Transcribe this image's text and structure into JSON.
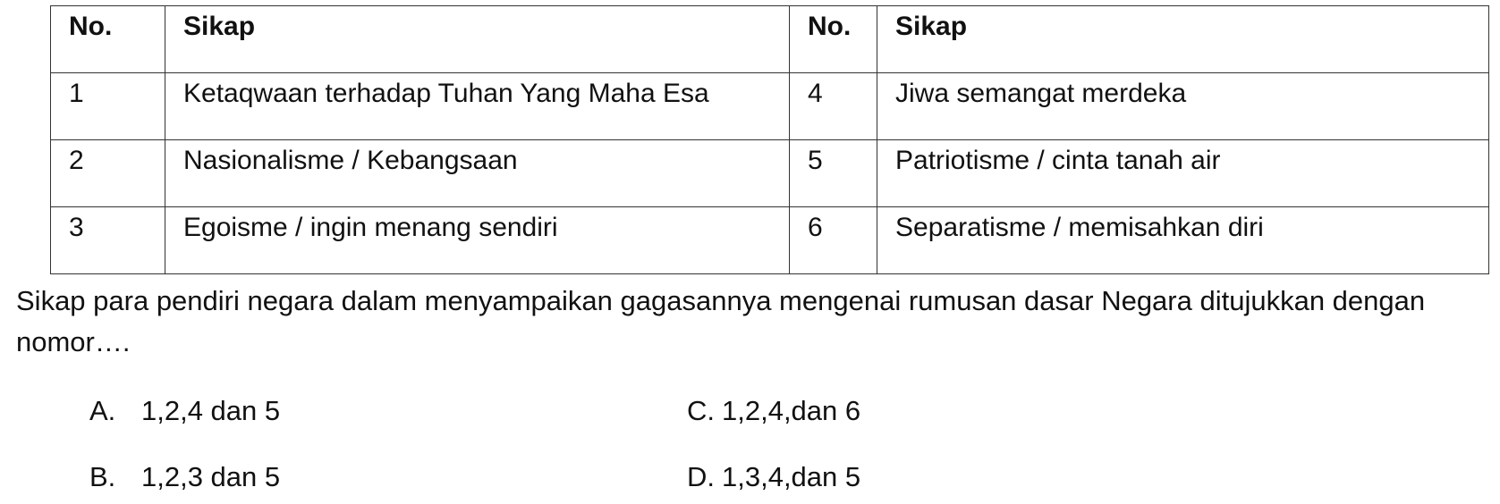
{
  "table": {
    "headers": [
      "No.",
      "Sikap",
      "No.",
      "Sikap"
    ],
    "rows": [
      [
        "1",
        "Ketaqwaan terhadap Tuhan Yang Maha Esa",
        "4",
        "Jiwa semangat merdeka"
      ],
      [
        "2",
        "Nasionalisme / Kebangsaan",
        "5",
        "Patriotisme / cinta tanah air"
      ],
      [
        "3",
        "Egoisme / ingin menang sendiri",
        "6",
        "Separatisme / memisahkan diri"
      ]
    ]
  },
  "question": "Sikap para pendiri negara dalam menyampaikan gagasannya mengenai rumusan dasar Negara ditujukkan dengan nomor….",
  "options": {
    "a": {
      "letter": "A.",
      "text": "1,2,4 dan 5"
    },
    "b": {
      "letter": "B.",
      "text": "1,2,3 dan 5"
    },
    "c": {
      "letter": "C.",
      "text": "1,2,4,dan 6"
    },
    "d": {
      "letter": "D.",
      "text": "1,3,4,dan 5"
    }
  }
}
